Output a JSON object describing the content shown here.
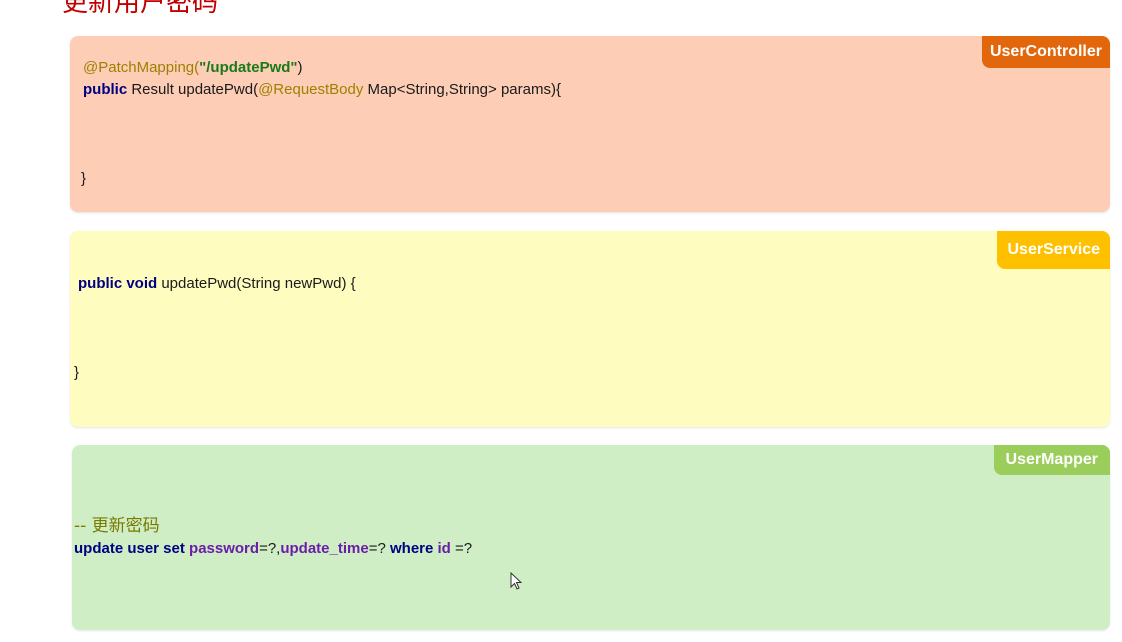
{
  "page": {
    "title": "更新用户密码"
  },
  "controller": {
    "tag": "UserController",
    "line1_annotation": "@PatchMapping(",
    "line1_string": "\"/updatePwd\"",
    "line1_close": ")",
    "line2_kw": "public",
    "line2_text1": " Result updatePwd(",
    "line2_annotation": "@RequestBody",
    "line2_text2": " Map<String,String> params){",
    "closing_brace": "}"
  },
  "service": {
    "tag": "UserService",
    "line1_kw": "public void",
    "line1_text": " updatePwd(String newPwd) {",
    "closing_brace": "}"
  },
  "mapper": {
    "tag": "UserMapper",
    "comment": "-- 更新密码",
    "sql_kw1": "update user set",
    "sql_field1": " password",
    "sql_text1": "=?,",
    "sql_field2": "update_time",
    "sql_text2": "=? ",
    "sql_kw2": "where",
    "sql_field3": " id",
    "sql_text3": " =?"
  },
  "icons": {
    "cursor": "mouse-pointer-icon"
  },
  "colors": {
    "title": "#c00000",
    "controller_bg": "#fdcdb5",
    "controller_tag": "#e2670c",
    "service_bg": "#fffcc0",
    "service_tag": "#ffc000",
    "mapper_bg": "#cfeec6",
    "mapper_tag": "#9acd5a"
  }
}
